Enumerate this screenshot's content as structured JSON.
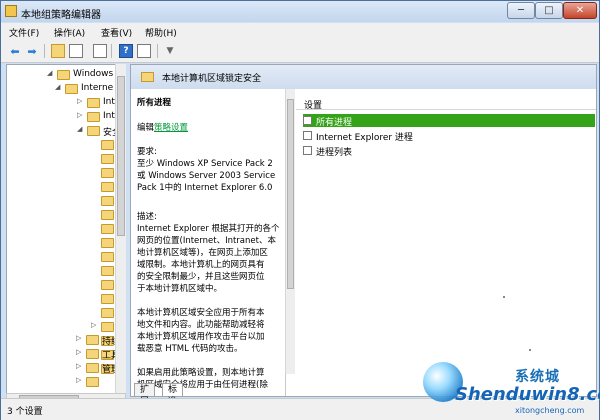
{
  "window": {
    "title": "本地组策略编辑器",
    "min": "─",
    "max": "□",
    "close": "✕"
  },
  "menu": [
    "文件(F)",
    "操作(A)",
    "查看(V)",
    "帮助(H)"
  ],
  "toolbar": {
    "back": "⬅",
    "forward": "➡",
    "help": "?",
    "filter": "▼"
  },
  "tree": {
    "items": [
      {
        "label": "Windows S",
        "expander": "◢"
      },
      {
        "label": "Interne",
        "expander": "◢"
      },
      {
        "label": "Inte",
        "expander": "▷"
      },
      {
        "label": "Inte",
        "expander": "▷"
      },
      {
        "label": "安全",
        "expander": "◢"
      },
      {
        "label": "",
        "expander": ""
      },
      {
        "label": "",
        "expander": ""
      },
      {
        "label": "",
        "expander": ""
      },
      {
        "label": "",
        "expander": ""
      },
      {
        "label": "",
        "expander": ""
      },
      {
        "label": "",
        "expander": ""
      },
      {
        "label": "",
        "expander": ""
      },
      {
        "label": "",
        "expander": ""
      },
      {
        "label": "",
        "expander": ""
      },
      {
        "label": "",
        "expander": ""
      },
      {
        "label": "",
        "expander": ""
      },
      {
        "label": "",
        "expander": ""
      },
      {
        "label": "",
        "expander": ""
      },
      {
        "label": "",
        "expander": "▷"
      },
      {
        "label": "",
        "expander": ""
      },
      {
        "label": "",
        "expander": ""
      },
      {
        "label": "",
        "expander": ""
      },
      {
        "label": "持续",
        "expander": "▷"
      },
      {
        "label": "工具",
        "expander": "▷"
      },
      {
        "label": "管理",
        "expander": "▷"
      },
      {
        "label": "",
        "expander": "▷"
      }
    ]
  },
  "panel": {
    "title": "本地计算机区域锁定安全"
  },
  "description": {
    "title": "所有进程",
    "edit_prefix": "编辑",
    "edit_link": "策略设置",
    "lines": [
      "要求:",
      "至少 Windows XP Service Pack 2",
      "或 Windows Server 2003 Service",
      "Pack 1中的 Internet Explorer 6.0",
      "描述:",
      "Internet Explorer 根据其打开的各个",
      "网页的位置(Internet、Intranet、本",
      "地计算机区域等)，在网页上添加区",
      "域限制。本地计算机上的网页具有",
      "的安全限制最少，并且这些网页位",
      "于本地计算机区域中。",
      "本地计算机区域安全应用于所有本",
      "地文件和内容。此功能帮助减轻将",
      "本地计算机区域用作攻击平台以加",
      "载恶意 HTML 代码的攻击。",
      "如果启用此策略设置，则本地计算",
      "机区域安全将应用于由任何进程(除"
    ]
  },
  "settings": {
    "header": "设置",
    "items": [
      "所有进程",
      "Internet Explorer 进程",
      "进程列表"
    ]
  },
  "tabs": [
    "扩展",
    "标准"
  ],
  "status": "3 个设置",
  "watermark": {
    "top": "系统城",
    "main": "Shenduwin8.com",
    "sub": "xitongcheng.com"
  },
  "colors": {
    "selected": "#35a318",
    "link": "#009a3a",
    "titlebar": "#c2d6ee"
  }
}
